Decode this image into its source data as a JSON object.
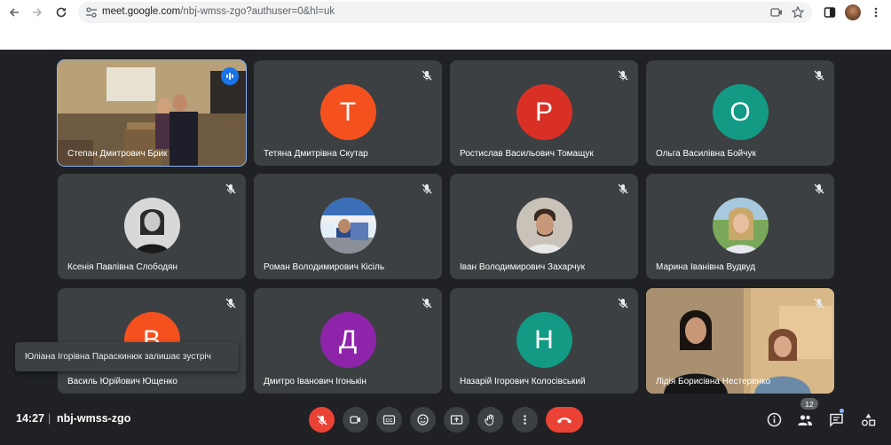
{
  "browser": {
    "url_host": "meet.google.com",
    "url_path": "/nbj-wmss-zgo?authuser=0&hl=uk"
  },
  "tiles": [
    {
      "name": "Степан Дмитрович Брик",
      "type": "video",
      "speaking": true
    },
    {
      "name": "Тетяна Дмитрівна Скутар",
      "type": "initial",
      "initial": "Т",
      "color": "#f4511e"
    },
    {
      "name": "Ростислав Васильович Томащук",
      "type": "initial",
      "initial": "Р",
      "color": "#d93025"
    },
    {
      "name": "Ольга Василівна Бойчук",
      "type": "initial",
      "initial": "О",
      "color": "#129a84"
    },
    {
      "name": "Ксенія Павлівна Слободян",
      "type": "photo"
    },
    {
      "name": "Роман Володимирович Кісіль",
      "type": "photo"
    },
    {
      "name": "Іван Володимирович Захарчук",
      "type": "photo"
    },
    {
      "name": "Марина Іванівна Вудвуд",
      "type": "photo"
    },
    {
      "name": "Василь Юрійович Ющенко",
      "type": "initial",
      "initial": "В",
      "color": "#f4511e"
    },
    {
      "name": "Дмитро Іванович Ігонькін",
      "type": "initial",
      "initial": "Д",
      "color": "#8e24aa"
    },
    {
      "name": "Назарій Ігорович Колосівський",
      "type": "initial",
      "initial": "Н",
      "color": "#129a84"
    },
    {
      "name": "Лідія Борисівна Нестеренко",
      "type": "video"
    }
  ],
  "toast": "Юліана Ігорівна Параскинюк залишає зустріч",
  "meeting": {
    "time": "14:27",
    "separator": "|",
    "code": "nbj-wmss-zgo",
    "people_count": "12"
  }
}
